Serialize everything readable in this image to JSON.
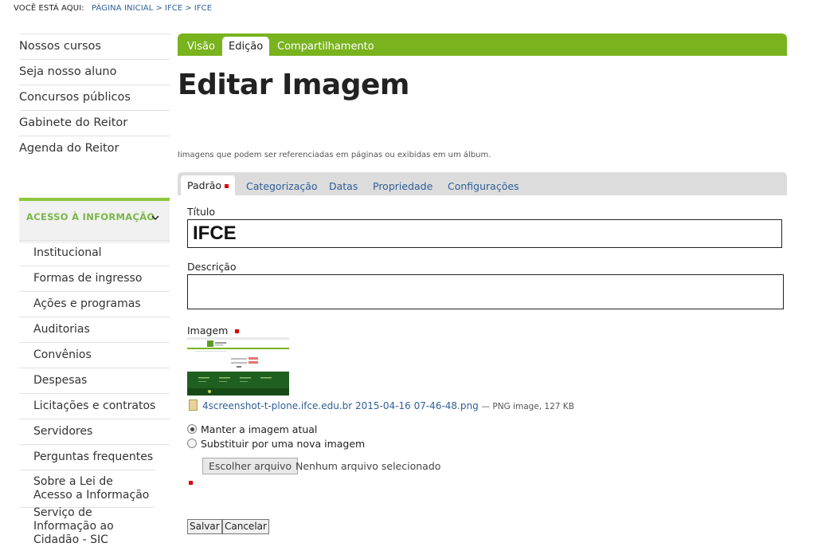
{
  "breadcrumb": {
    "label": "VOCÊ ESTÁ AQUI:",
    "items": [
      "PÁGINA INICIAL",
      "IFCE",
      "IFCE"
    ],
    "separator": ">"
  },
  "sidebar": {
    "top_items": [
      "Nossos cursos",
      "Seja nosso aluno",
      "Concursos públicos",
      "Gabinete do Reitor",
      "Agenda do Reitor"
    ],
    "section_title": "ACESSO À INFORMAÇÃO",
    "section_items": [
      "Institucional",
      "Formas de ingresso",
      "Ações e programas",
      "Auditorias",
      "Convênios",
      "Despesas",
      "Licitações e contratos",
      "Servidores",
      "Perguntas frequentes",
      "Sobre a Lei de Acesso a Informação",
      "Serviço de Informação ao Cidadão - SIC"
    ]
  },
  "content_tabs": {
    "visao": "Visão",
    "edicao": "Edição",
    "compartilhamento": "Compartilhamento",
    "active": "Edição"
  },
  "page": {
    "title": "Editar Imagem",
    "description": "Iimagens que podem ser referenciadas em páginas ou exibidas em um álbum."
  },
  "form_tabs": {
    "padrao": "Padrão",
    "categorizacao": "Categorização",
    "datas": "Datas",
    "propriedade": "Propriedade",
    "configuracoes": "Configurações",
    "active": "Padrão"
  },
  "form": {
    "titulo_label": "Título",
    "titulo_value": "IFCE",
    "descricao_label": "Descrição",
    "descricao_value": "",
    "imagem_label": "Imagem",
    "file_name": "4screenshot-t-plone.ifce.edu.br 2015-04-16 07-46-48.png",
    "file_meta": "— PNG image, 127 KB",
    "radio_keep": "Manter a imagem atual",
    "radio_replace": "Substituir por uma nova imagem",
    "selected_radio": "keep",
    "file_button": "Escolher arquivo",
    "file_none": "Nenhum arquivo selecionado",
    "save_button": "Salvar",
    "cancel_button": "Cancelar"
  },
  "colors": {
    "brand_green": "#79b31e",
    "accent_green": "#8cc63f",
    "link_blue": "#2f5f97",
    "required_red": "#dd0000"
  }
}
